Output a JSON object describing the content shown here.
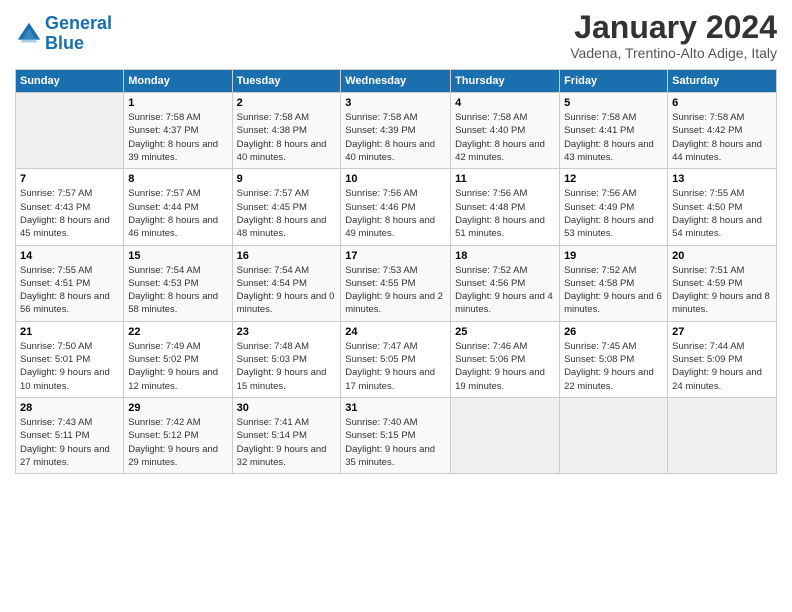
{
  "header": {
    "logo_line1": "General",
    "logo_line2": "Blue",
    "month": "January 2024",
    "location": "Vadena, Trentino-Alto Adige, Italy"
  },
  "weekdays": [
    "Sunday",
    "Monday",
    "Tuesday",
    "Wednesday",
    "Thursday",
    "Friday",
    "Saturday"
  ],
  "weeks": [
    [
      {
        "day": "",
        "sunrise": "",
        "sunset": "",
        "daylight": ""
      },
      {
        "day": "1",
        "sunrise": "7:58 AM",
        "sunset": "4:37 PM",
        "daylight": "8 hours and 39 minutes."
      },
      {
        "day": "2",
        "sunrise": "7:58 AM",
        "sunset": "4:38 PM",
        "daylight": "8 hours and 40 minutes."
      },
      {
        "day": "3",
        "sunrise": "7:58 AM",
        "sunset": "4:39 PM",
        "daylight": "8 hours and 40 minutes."
      },
      {
        "day": "4",
        "sunrise": "7:58 AM",
        "sunset": "4:40 PM",
        "daylight": "8 hours and 42 minutes."
      },
      {
        "day": "5",
        "sunrise": "7:58 AM",
        "sunset": "4:41 PM",
        "daylight": "8 hours and 43 minutes."
      },
      {
        "day": "6",
        "sunrise": "7:58 AM",
        "sunset": "4:42 PM",
        "daylight": "8 hours and 44 minutes."
      }
    ],
    [
      {
        "day": "7",
        "sunrise": "7:57 AM",
        "sunset": "4:43 PM",
        "daylight": "8 hours and 45 minutes."
      },
      {
        "day": "8",
        "sunrise": "7:57 AM",
        "sunset": "4:44 PM",
        "daylight": "8 hours and 46 minutes."
      },
      {
        "day": "9",
        "sunrise": "7:57 AM",
        "sunset": "4:45 PM",
        "daylight": "8 hours and 48 minutes."
      },
      {
        "day": "10",
        "sunrise": "7:56 AM",
        "sunset": "4:46 PM",
        "daylight": "8 hours and 49 minutes."
      },
      {
        "day": "11",
        "sunrise": "7:56 AM",
        "sunset": "4:48 PM",
        "daylight": "8 hours and 51 minutes."
      },
      {
        "day": "12",
        "sunrise": "7:56 AM",
        "sunset": "4:49 PM",
        "daylight": "8 hours and 53 minutes."
      },
      {
        "day": "13",
        "sunrise": "7:55 AM",
        "sunset": "4:50 PM",
        "daylight": "8 hours and 54 minutes."
      }
    ],
    [
      {
        "day": "14",
        "sunrise": "7:55 AM",
        "sunset": "4:51 PM",
        "daylight": "8 hours and 56 minutes."
      },
      {
        "day": "15",
        "sunrise": "7:54 AM",
        "sunset": "4:53 PM",
        "daylight": "8 hours and 58 minutes."
      },
      {
        "day": "16",
        "sunrise": "7:54 AM",
        "sunset": "4:54 PM",
        "daylight": "9 hours and 0 minutes."
      },
      {
        "day": "17",
        "sunrise": "7:53 AM",
        "sunset": "4:55 PM",
        "daylight": "9 hours and 2 minutes."
      },
      {
        "day": "18",
        "sunrise": "7:52 AM",
        "sunset": "4:56 PM",
        "daylight": "9 hours and 4 minutes."
      },
      {
        "day": "19",
        "sunrise": "7:52 AM",
        "sunset": "4:58 PM",
        "daylight": "9 hours and 6 minutes."
      },
      {
        "day": "20",
        "sunrise": "7:51 AM",
        "sunset": "4:59 PM",
        "daylight": "9 hours and 8 minutes."
      }
    ],
    [
      {
        "day": "21",
        "sunrise": "7:50 AM",
        "sunset": "5:01 PM",
        "daylight": "9 hours and 10 minutes."
      },
      {
        "day": "22",
        "sunrise": "7:49 AM",
        "sunset": "5:02 PM",
        "daylight": "9 hours and 12 minutes."
      },
      {
        "day": "23",
        "sunrise": "7:48 AM",
        "sunset": "5:03 PM",
        "daylight": "9 hours and 15 minutes."
      },
      {
        "day": "24",
        "sunrise": "7:47 AM",
        "sunset": "5:05 PM",
        "daylight": "9 hours and 17 minutes."
      },
      {
        "day": "25",
        "sunrise": "7:46 AM",
        "sunset": "5:06 PM",
        "daylight": "9 hours and 19 minutes."
      },
      {
        "day": "26",
        "sunrise": "7:45 AM",
        "sunset": "5:08 PM",
        "daylight": "9 hours and 22 minutes."
      },
      {
        "day": "27",
        "sunrise": "7:44 AM",
        "sunset": "5:09 PM",
        "daylight": "9 hours and 24 minutes."
      }
    ],
    [
      {
        "day": "28",
        "sunrise": "7:43 AM",
        "sunset": "5:11 PM",
        "daylight": "9 hours and 27 minutes."
      },
      {
        "day": "29",
        "sunrise": "7:42 AM",
        "sunset": "5:12 PM",
        "daylight": "9 hours and 29 minutes."
      },
      {
        "day": "30",
        "sunrise": "7:41 AM",
        "sunset": "5:14 PM",
        "daylight": "9 hours and 32 minutes."
      },
      {
        "day": "31",
        "sunrise": "7:40 AM",
        "sunset": "5:15 PM",
        "daylight": "9 hours and 35 minutes."
      },
      {
        "day": "",
        "sunrise": "",
        "sunset": "",
        "daylight": ""
      },
      {
        "day": "",
        "sunrise": "",
        "sunset": "",
        "daylight": ""
      },
      {
        "day": "",
        "sunrise": "",
        "sunset": "",
        "daylight": ""
      }
    ]
  ]
}
